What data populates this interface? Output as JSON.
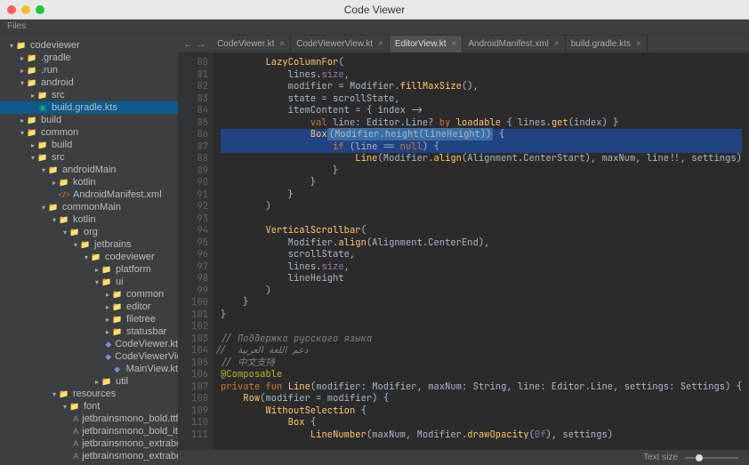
{
  "titlebar": {
    "title": "Code Viewer"
  },
  "sidebar": {
    "header": "Files"
  },
  "tree": [
    {
      "label": "codeviewer",
      "depth": 0,
      "type": "folder",
      "state": "open"
    },
    {
      "label": ".gradle",
      "depth": 1,
      "type": "folder",
      "state": "closed"
    },
    {
      "label": ".run",
      "depth": 1,
      "type": "folder",
      "state": "closed"
    },
    {
      "label": "android",
      "depth": 1,
      "type": "folder",
      "state": "open"
    },
    {
      "label": "src",
      "depth": 2,
      "type": "folder",
      "state": "closed"
    },
    {
      "label": "build.gradle.kts",
      "depth": 2,
      "type": "grad",
      "selected": true
    },
    {
      "label": "build",
      "depth": 1,
      "type": "folder",
      "state": "closed"
    },
    {
      "label": "common",
      "depth": 1,
      "type": "folder",
      "state": "open"
    },
    {
      "label": "build",
      "depth": 2,
      "type": "folder",
      "state": "closed"
    },
    {
      "label": "src",
      "depth": 2,
      "type": "folder",
      "state": "open"
    },
    {
      "label": "androidMain",
      "depth": 3,
      "type": "folder",
      "state": "open"
    },
    {
      "label": "kotlin",
      "depth": 4,
      "type": "folder",
      "state": "closed"
    },
    {
      "label": "AndroidManifest.xml",
      "depth": 4,
      "type": "xml"
    },
    {
      "label": "commonMain",
      "depth": 3,
      "type": "folder",
      "state": "open"
    },
    {
      "label": "kotlin",
      "depth": 4,
      "type": "folder",
      "state": "open"
    },
    {
      "label": "org",
      "depth": 5,
      "type": "folder",
      "state": "open"
    },
    {
      "label": "jetbrains",
      "depth": 6,
      "type": "folder",
      "state": "open"
    },
    {
      "label": "codeviewer",
      "depth": 7,
      "type": "folder",
      "state": "open"
    },
    {
      "label": "platform",
      "depth": 8,
      "type": "folder",
      "state": "closed"
    },
    {
      "label": "ui",
      "depth": 8,
      "type": "folder",
      "state": "open"
    },
    {
      "label": "common",
      "depth": 9,
      "type": "folder",
      "state": "closed"
    },
    {
      "label": "editor",
      "depth": 9,
      "type": "folder",
      "state": "closed"
    },
    {
      "label": "filetree",
      "depth": 9,
      "type": "folder",
      "state": "closed"
    },
    {
      "label": "statusbar",
      "depth": 9,
      "type": "folder",
      "state": "closed"
    },
    {
      "label": "CodeViewer.kt",
      "depth": 9,
      "type": "kt"
    },
    {
      "label": "CodeViewerView.kt",
      "depth": 9,
      "type": "kt"
    },
    {
      "label": "MainView.kt",
      "depth": 9,
      "type": "kt"
    },
    {
      "label": "util",
      "depth": 8,
      "type": "folder",
      "state": "closed"
    },
    {
      "label": "resources",
      "depth": 4,
      "type": "folder",
      "state": "open"
    },
    {
      "label": "font",
      "depth": 5,
      "type": "folder",
      "state": "open"
    },
    {
      "label": "jetbrainsmono_bold.ttf",
      "depth": 6,
      "type": "ttf"
    },
    {
      "label": "jetbrainsmono_bold_italic.ttf",
      "depth": 6,
      "type": "ttf"
    },
    {
      "label": "jetbrainsmono_extrabold.ttf",
      "depth": 6,
      "type": "ttf"
    },
    {
      "label": "jetbrainsmono_extrabold_italic.ttf",
      "depth": 6,
      "type": "ttf"
    }
  ],
  "tabs": [
    {
      "label": "CodeViewer.kt",
      "active": false
    },
    {
      "label": "CodeViewerView.kt",
      "active": false
    },
    {
      "label": "EditorView.kt",
      "active": true
    },
    {
      "label": "AndroidManifest.xml",
      "active": false
    },
    {
      "label": "build.gradle.kts",
      "active": false
    }
  ],
  "code": {
    "first_line": 80,
    "lines": [
      {
        "n": 80,
        "html": "        <span class='fn'>LazyColumnFor</span>("
      },
      {
        "n": 81,
        "html": "            lines.<span class='prop'>size</span>,"
      },
      {
        "n": 82,
        "html": "            modifier = Modifier.<span class='fn'>fillMaxSize</span>(),"
      },
      {
        "n": 83,
        "html": "            state = scrollState,"
      },
      {
        "n": 84,
        "html": "            itemContent = { index -&gt;"
      },
      {
        "n": 85,
        "html": "                <span class='kw'>val</span> line: Editor.Line? <span class='kw'>by</span> <span class='fn'>loadable</span> { lines.<span class='fn'>get</span>(index) }"
      },
      {
        "n": 86,
        "html": "                <span class='fn'>Box</span><span class='sel-range'>(Modifier.height(lineHeight))</span> {",
        "hl": true
      },
      {
        "n": 87,
        "html": "                    <span class='kw'>if</span> (line == <span class='kw'>null</span>) {",
        "hl": true
      },
      {
        "n": 88,
        "html": "                        <span class='fn'>Line</span>(Modifier.<span class='fn'>align</span>(Alignment.CenterStart), maxNum, line!!, settings)"
      },
      {
        "n": 89,
        "html": "                    }"
      },
      {
        "n": 90,
        "html": "                }"
      },
      {
        "n": 91,
        "html": "            }"
      },
      {
        "n": 92,
        "html": "        )"
      },
      {
        "n": 93,
        "html": ""
      },
      {
        "n": 94,
        "html": "        <span class='fn'>VerticalScrollbar</span>("
      },
      {
        "n": 95,
        "html": "            Modifier.<span class='fn'>align</span>(Alignment.CenterEnd),"
      },
      {
        "n": 96,
        "html": "            scrollState,"
      },
      {
        "n": 97,
        "html": "            lines.<span class='prop'>size</span>,"
      },
      {
        "n": 98,
        "html": "            lineHeight"
      },
      {
        "n": 99,
        "html": "        )"
      },
      {
        "n": 100,
        "html": "    }"
      },
      {
        "n": 101,
        "html": "}"
      },
      {
        "n": 102,
        "html": ""
      },
      {
        "n": 103,
        "html": "<span class='comm'>// Поддержка русского языка</span>"
      },
      {
        "n": 104,
        "html": "<span class='comm'>// دعم اللغة العربية</span>"
      },
      {
        "n": 105,
        "html": "<span class='comm'>// 中文支持</span>"
      },
      {
        "n": 106,
        "html": "<span class='anno'>@Composable</span>"
      },
      {
        "n": 107,
        "html": "<span class='kw'>private fun</span> <span class='fn'>Line</span>(modifier: Modifier, maxNum: String, line: Editor.Line, settings: Settings) {"
      },
      {
        "n": 108,
        "html": "    <span class='fn'>Row</span>(modifier = modifier) {"
      },
      {
        "n": 109,
        "html": "        <span class='fn'>WithoutSelection</span> {"
      },
      {
        "n": 110,
        "html": "            <span class='fn'>Box</span> {"
      },
      {
        "n": 111,
        "html": "                <span class='fn'>LineNumber</span>(maxNum, Modifier.<span class='fn'>drawOpacity</span>(<span class='prop'>0f</span>), settings)"
      }
    ]
  },
  "statusbar": {
    "label": "Text size"
  }
}
